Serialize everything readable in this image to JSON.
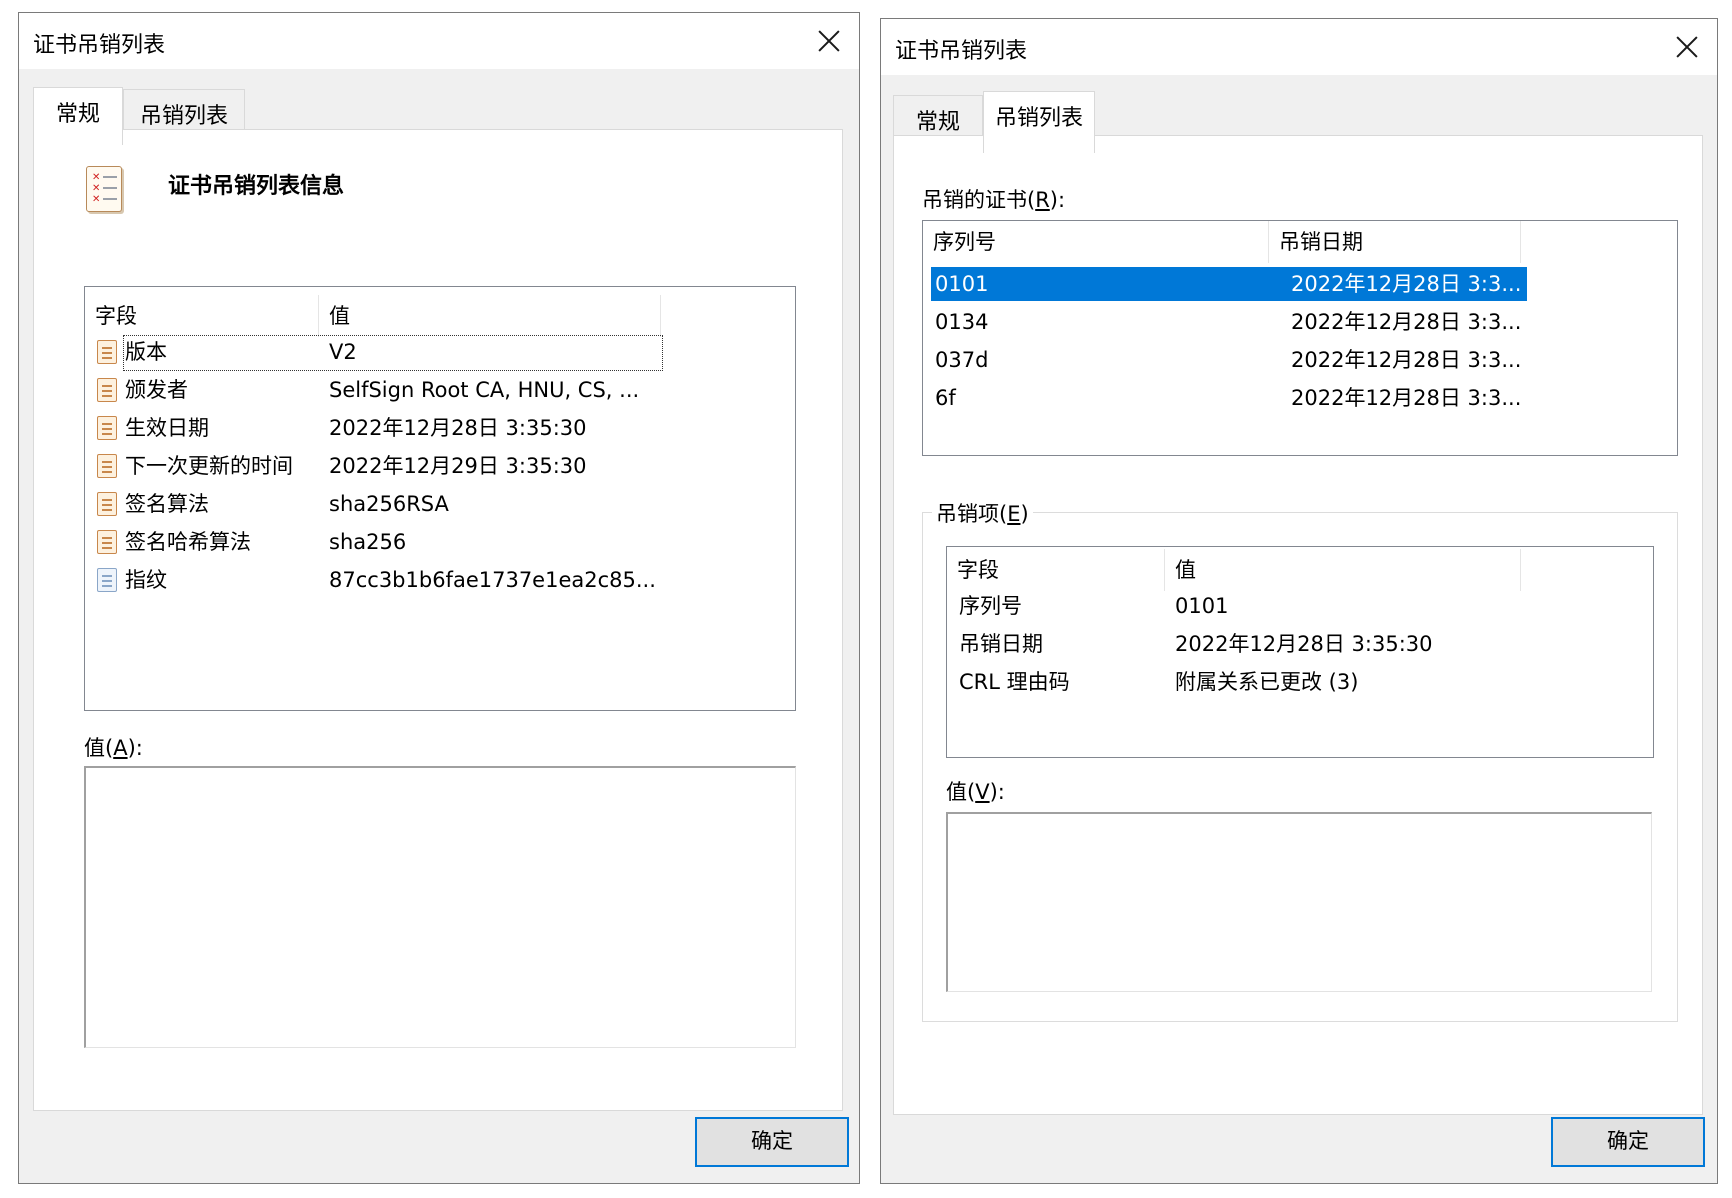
{
  "left_dialog": {
    "title": "证书吊销列表",
    "tabs": [
      "常规",
      "吊销列表"
    ],
    "active_tab": "常规",
    "info_heading": "证书吊销列表信息",
    "columns": [
      "字段",
      "值"
    ],
    "rows": [
      {
        "field": "版本",
        "value": "V2"
      },
      {
        "field": "颁发者",
        "value": "SelfSign Root CA, HNU, CS, ..."
      },
      {
        "field": "生效日期",
        "value": "2022年12月28日 3:35:30"
      },
      {
        "field": "下一次更新的时间",
        "value": "2022年12月29日 3:35:30"
      },
      {
        "field": "签名算法",
        "value": "sha256RSA"
      },
      {
        "field": "签名哈希算法",
        "value": "sha256"
      },
      {
        "field": "指纹",
        "value": "87cc3b1b6fae1737e1ea2c85..."
      }
    ],
    "selected_row": "版本",
    "value_label_prefix": "值(",
    "value_label_key": "A",
    "value_label_suffix": "):",
    "ok_button": "确定"
  },
  "right_dialog": {
    "title": "证书吊销列表",
    "tabs": [
      "常规",
      "吊销列表"
    ],
    "active_tab": "吊销列表",
    "revoked_label_prefix": "吊销的证书(",
    "revoked_label_key": "R",
    "revoked_label_suffix": "):",
    "revoked_columns": [
      "序列号",
      "吊销日期"
    ],
    "revoked_rows": [
      {
        "serial": "0101",
        "date": "2022年12月28日 3:3..."
      },
      {
        "serial": "0134",
        "date": "2022年12月28日 3:3..."
      },
      {
        "serial": "037d",
        "date": "2022年12月28日 3:3..."
      },
      {
        "serial": "6f",
        "date": "2022年12月28日 3:3..."
      }
    ],
    "selected_serial": "0101",
    "entry_label_prefix": "吊销项(",
    "entry_label_key": "E",
    "entry_label_suffix": ")",
    "entry_columns": [
      "字段",
      "值"
    ],
    "entry_rows": [
      {
        "field": "序列号",
        "value": "0101"
      },
      {
        "field": "吊销日期",
        "value": "2022年12月28日 3:35:30"
      },
      {
        "field": "CRL 理由码",
        "value": "附属关系已更改 (3)"
      }
    ],
    "value_label_prefix": "值(",
    "value_label_key": "V",
    "value_label_suffix": "):",
    "ok_button": "确定"
  },
  "colors": {
    "selection": "#0078d7",
    "button_border": "#0078d7",
    "dialog_bg": "#f0f0f0"
  },
  "icons": [
    "close-icon",
    "crl-document-icon",
    "certificate-field-icon",
    "thumbprint-icon"
  ]
}
